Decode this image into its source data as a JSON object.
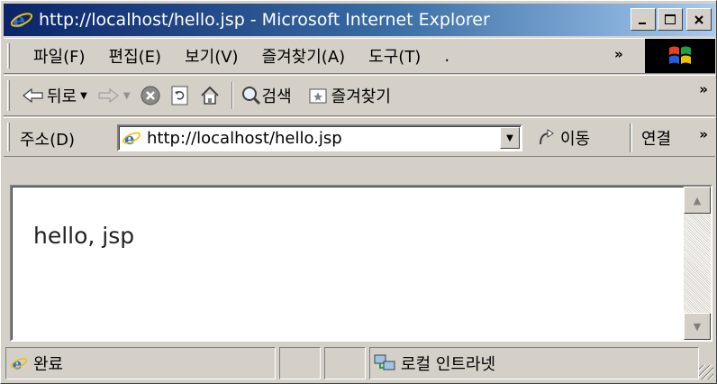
{
  "window": {
    "title": "http://localhost/hello.jsp - Microsoft Internet Explorer"
  },
  "menu": {
    "items": [
      "파일(F)",
      "편집(E)",
      "보기(V)",
      "즐겨찾기(A)",
      "도구(T)"
    ],
    "overflow": "."
  },
  "toolbar": {
    "back_label": "뒤로",
    "search_label": "검색",
    "favorites_label": "즐겨찾기"
  },
  "address": {
    "label": "주소(D)",
    "url": "http://localhost/hello.jsp",
    "go_label": "이동",
    "links_label": "연결"
  },
  "page": {
    "text": "hello, jsp"
  },
  "status": {
    "text": "완료",
    "zone": "로컬 인트라넷"
  },
  "icons": {
    "title": "ie-icon",
    "back": "back-arrow-icon",
    "forward": "forward-arrow-icon",
    "stop": "stop-icon",
    "refresh": "refresh-icon",
    "home": "home-icon",
    "search": "search-icon",
    "favorites": "favorites-icon",
    "go": "go-icon",
    "zone": "intranet-icon"
  },
  "colors": {
    "titlebar_start": "#0a246a",
    "titlebar_end": "#a6caf0",
    "chrome": "#d4d0c8"
  }
}
